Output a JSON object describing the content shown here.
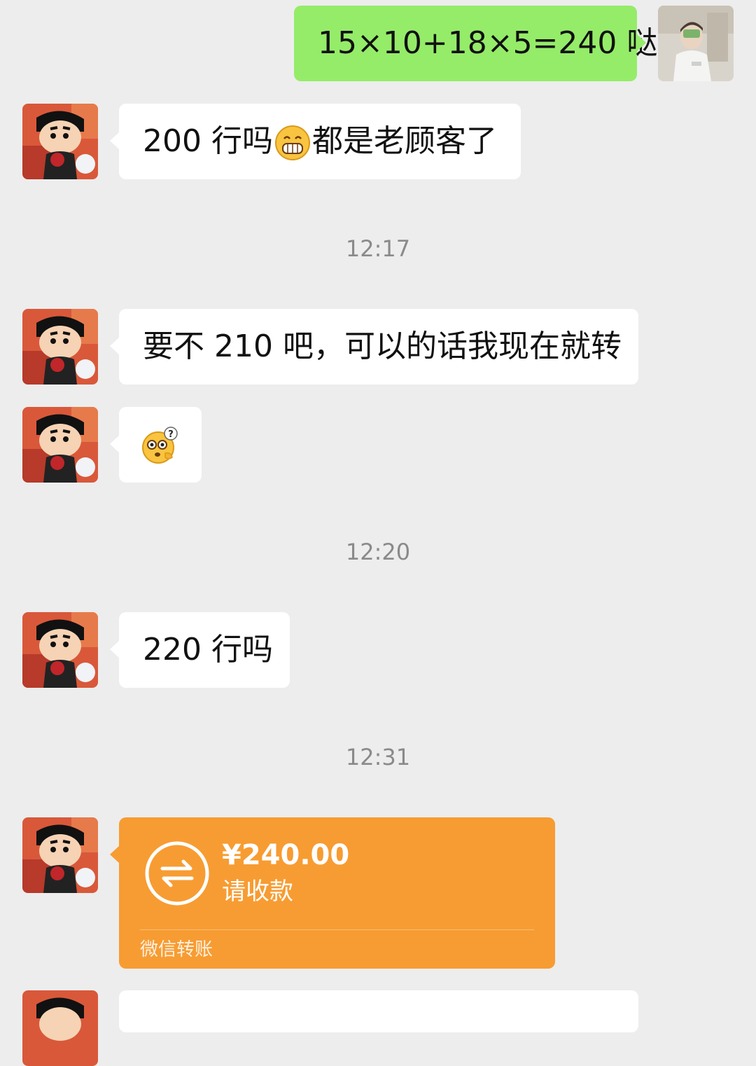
{
  "messages": {
    "m1": {
      "from": "me",
      "text": "15×10+18×5=240 哒"
    },
    "m2": {
      "from": "contact",
      "text_before": "200 行吗",
      "emoji": "grinning-face-emoji",
      "text_after": "都是老顾客了"
    },
    "t1": "12:17",
    "m3": {
      "from": "contact",
      "text": "要不 210 吧，可以的话我现在就转"
    },
    "m4": {
      "from": "contact",
      "emoji": "confused-question-emoji"
    },
    "t2": "12:20",
    "m5": {
      "from": "contact",
      "text": "220 行吗"
    },
    "t3": "12:31",
    "transfer": {
      "amount": "¥240.00",
      "status": "请收款",
      "footer": "微信转账",
      "icon": "transfer-arrows-icon"
    }
  },
  "colors": {
    "background": "#ededed",
    "outgoing_bubble": "#95ec69",
    "incoming_bubble": "#ffffff",
    "transfer_card": "#f79c32",
    "timestamp_text": "#8a8a8a"
  }
}
